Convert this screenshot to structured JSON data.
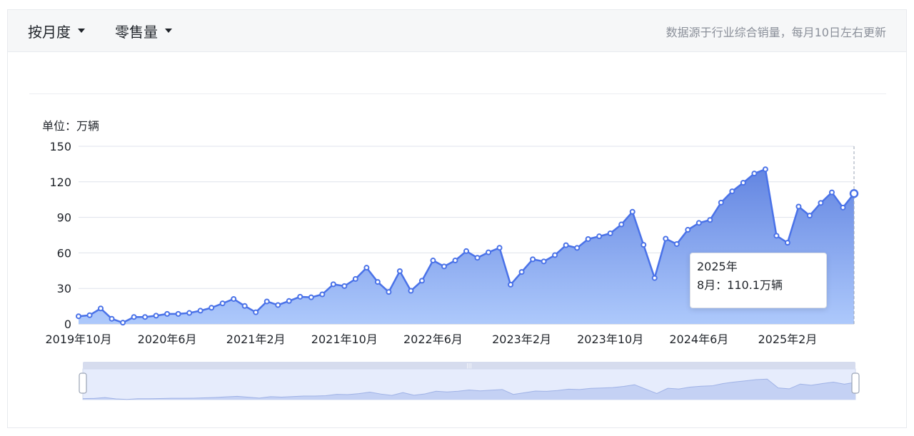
{
  "controls": {
    "period_label": "按月度",
    "metric_label": "零售量",
    "source_note": "数据源于行业综合销量，每月10日左右更新"
  },
  "chart_data": {
    "type": "area",
    "ylabel": "单位：万辆",
    "ylim": [
      0,
      150
    ],
    "yticks": [
      0,
      30,
      60,
      90,
      120,
      150
    ],
    "grid": true,
    "x": [
      "2019年10月",
      "2019年11月",
      "2019年12月",
      "2020年1月",
      "2020年2月",
      "2020年3月",
      "2020年4月",
      "2020年5月",
      "2020年6月",
      "2020年7月",
      "2020年8月",
      "2020年9月",
      "2020年10月",
      "2020年11月",
      "2020年12月",
      "2021年1月",
      "2021年2月",
      "2021年3月",
      "2021年4月",
      "2021年5月",
      "2021年6月",
      "2021年7月",
      "2021年8月",
      "2021年9月",
      "2021年10月",
      "2021年11月",
      "2021年12月",
      "2022年1月",
      "2022年2月",
      "2022年3月",
      "2022年4月",
      "2022年5月",
      "2022年6月",
      "2022年7月",
      "2022年8月",
      "2022年9月",
      "2022年10月",
      "2022年11月",
      "2022年12月",
      "2023年1月",
      "2023年2月",
      "2023年3月",
      "2023年4月",
      "2023年5月",
      "2023年6月",
      "2023年7月",
      "2023年8月",
      "2023年9月",
      "2023年10月",
      "2023年11月",
      "2023年12月",
      "2024年1月",
      "2024年2月",
      "2024年3月",
      "2024年4月",
      "2024年5月",
      "2024年6月",
      "2024年7月",
      "2024年8月",
      "2024年9月",
      "2024年10月",
      "2024年11月",
      "2024年12月",
      "2025年1月",
      "2025年2月",
      "2025年3月",
      "2025年4月",
      "2025年5月",
      "2025年6月",
      "2025年7月",
      "2025年8月"
    ],
    "xtick_labels": [
      "2019年10月",
      "2020年6月",
      "2021年2月",
      "2021年10月",
      "2022年6月",
      "2023年2月",
      "2023年10月",
      "2024年6月",
      "2025年2月"
    ],
    "values": [
      6.5,
      7.4,
      13.1,
      4.4,
      1.1,
      5.9,
      5.9,
      7.0,
      8.5,
      8.5,
      9.3,
      11.2,
      13.7,
      17.4,
      21.1,
      15.2,
      9.9,
      19.0,
      16.0,
      19.4,
      23.0,
      22.5,
      25.0,
      33.5,
      32.0,
      38.0,
      47.5,
      35.5,
      27.0,
      44.6,
      28.0,
      36.5,
      53.6,
      48.6,
      53.6,
      61.5,
      55.9,
      60.5,
      64.3,
      33.2,
      43.9,
      54.6,
      52.8,
      58.1,
      66.5,
      64.2,
      71.7,
      74.0,
      76.5,
      84.0,
      94.7,
      66.8,
      38.8,
      72.0,
      67.5,
      79.5,
      85.3,
      87.8,
      102.5,
      112.0,
      119.2,
      127.0,
      130.6,
      74.5,
      68.6,
      99.1,
      91.5,
      102.2,
      111.1,
      98.3,
      110.1
    ],
    "color": "#4a72e8",
    "highlight": {
      "index": 70,
      "year_label": "2025年",
      "value_label": "8月：110.1万辆"
    }
  }
}
